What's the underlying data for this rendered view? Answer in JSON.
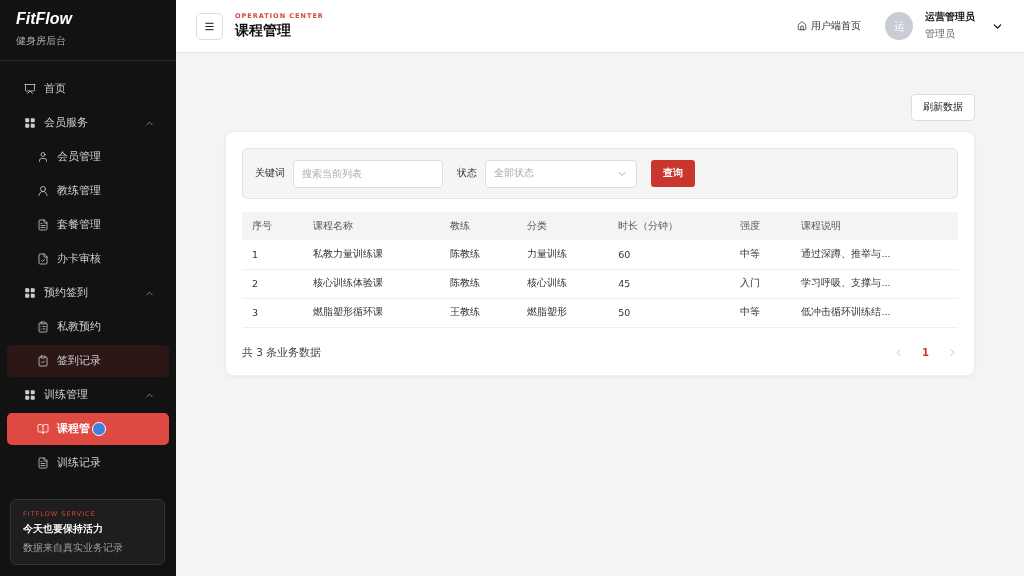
{
  "brand": {
    "logo": "FitFlow",
    "subtitle": "健身房后台"
  },
  "sidebar": {
    "items": [
      {
        "kind": "link",
        "label": "首页",
        "selected": false,
        "hovered": false
      },
      {
        "kind": "group",
        "label": "会员服务",
        "expanded": true,
        "children": [
          {
            "label": "会员管理",
            "selected": false,
            "hovered": false
          },
          {
            "label": "教练管理",
            "selected": false,
            "hovered": false
          },
          {
            "label": "套餐管理",
            "selected": false,
            "hovered": false
          },
          {
            "label": "办卡审核",
            "selected": false,
            "hovered": false
          }
        ]
      },
      {
        "kind": "group",
        "label": "预约签到",
        "expanded": true,
        "children": [
          {
            "label": "私教预约",
            "selected": false,
            "hovered": false
          },
          {
            "label": "签到记录",
            "selected": false,
            "hovered": true
          }
        ]
      },
      {
        "kind": "group",
        "label": "训练管理",
        "expanded": true,
        "children": [
          {
            "label": "课程管",
            "selected": true,
            "hovered": false
          },
          {
            "label": "训练记录",
            "selected": false,
            "hovered": false
          }
        ]
      }
    ]
  },
  "promo": {
    "eyebrow": "FITFLOW SERVICE",
    "title": "今天也要保持活力",
    "text": "数据来自真实业务记录"
  },
  "header": {
    "eyebrow": "OPERATION CENTER",
    "title": "课程管理",
    "home_link": "用户端首页",
    "avatar": "运",
    "user_name": "运营管理员",
    "user_role": "管理员"
  },
  "refresh_button": "刷新数据",
  "filters": {
    "keyword_label": "关键词",
    "keyword_placeholder": "搜索当前列表",
    "status_label": "状态",
    "status_value": "全部状态",
    "query_button": "查询"
  },
  "table": {
    "columns": [
      "序号",
      "课程名称",
      "教练",
      "分类",
      "时长（分钟）",
      "强度",
      "课程说明"
    ],
    "rows": [
      [
        "1",
        "私教力量训练课",
        "陈教练",
        "力量训练",
        "60",
        "中等",
        "通过深蹲、推举与..."
      ],
      [
        "2",
        "核心训练体验课",
        "陈教练",
        "核心训练",
        "45",
        "入门",
        "学习呼吸、支撑与..."
      ],
      [
        "3",
        "燃脂塑形循环课",
        "王教练",
        "燃脂塑形",
        "50",
        "中等",
        "低冲击循环训练结..."
      ]
    ]
  },
  "footer": {
    "total": "共 3 条业务数据",
    "pages": [
      {
        "label": "1",
        "selected": true
      }
    ]
  }
}
